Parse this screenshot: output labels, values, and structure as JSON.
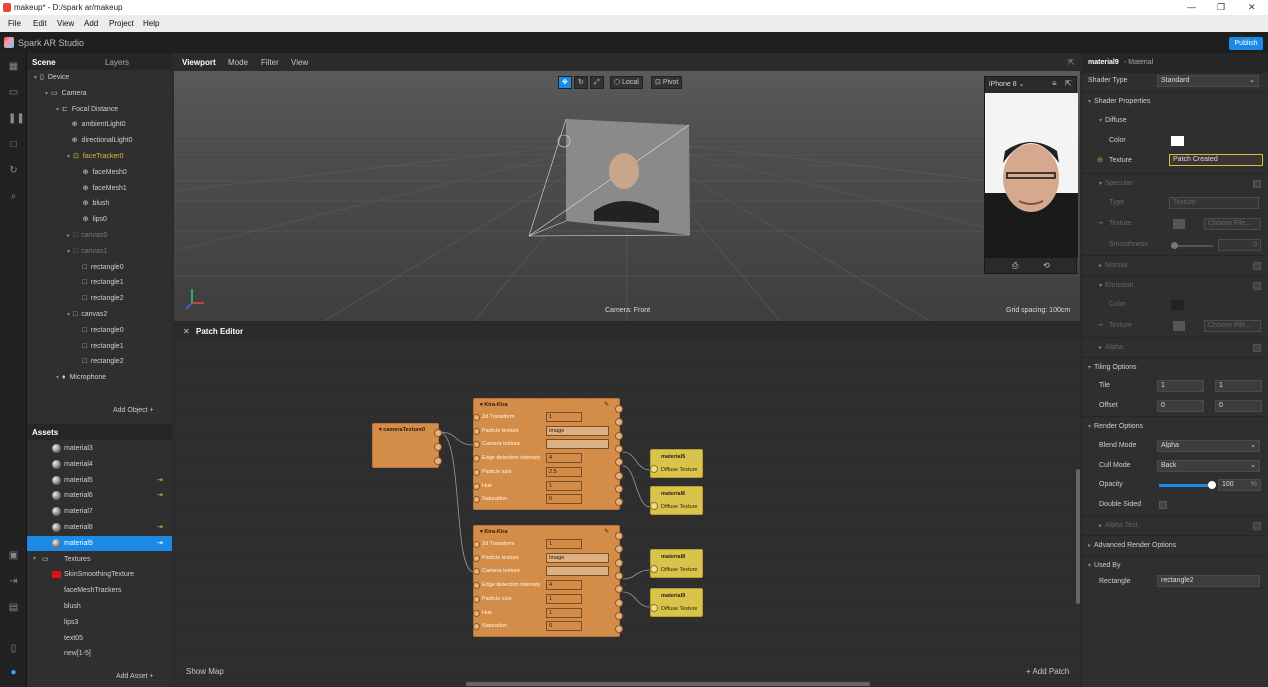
{
  "window": {
    "title": "makeup* - D:/spark ar/makeup"
  },
  "menu": [
    "File",
    "Edit",
    "View",
    "Add",
    "Project",
    "Help"
  ],
  "app": {
    "brand": "Spark AR Studio",
    "publish": "Publish"
  },
  "scene": {
    "tabs": [
      "Scene",
      "Layers"
    ],
    "tree": [
      {
        "label": "Device",
        "d": 0,
        "icon": "device"
      },
      {
        "label": "Camera",
        "d": 1,
        "icon": "camera"
      },
      {
        "label": "Focal Distance",
        "d": 2,
        "icon": "focal"
      },
      {
        "label": "ambientLight0",
        "d": 3,
        "icon": "globe"
      },
      {
        "label": "directionalLight0",
        "d": 3,
        "icon": "globe"
      },
      {
        "label": "faceTracker0",
        "d": 3,
        "icon": "face",
        "hl": true
      },
      {
        "label": "faceMesh0",
        "d": 4,
        "icon": "globe"
      },
      {
        "label": "faceMesh1",
        "d": 4,
        "icon": "globe"
      },
      {
        "label": "blush",
        "d": 4,
        "icon": "globe"
      },
      {
        "label": "lips0",
        "d": 4,
        "icon": "globe"
      },
      {
        "label": "canvas0",
        "d": 3,
        "icon": "box",
        "dim": true
      },
      {
        "label": "canvas1",
        "d": 3,
        "icon": "box",
        "dim": true
      },
      {
        "label": "rectangle0",
        "d": 4,
        "icon": "box"
      },
      {
        "label": "rectangle1",
        "d": 4,
        "icon": "box"
      },
      {
        "label": "rectangle2",
        "d": 4,
        "icon": "box"
      },
      {
        "label": "canvas2",
        "d": 3,
        "icon": "box"
      },
      {
        "label": "rectangle0",
        "d": 4,
        "icon": "box"
      },
      {
        "label": "rectangle1",
        "d": 4,
        "icon": "box"
      },
      {
        "label": "rectangle2",
        "d": 4,
        "icon": "box"
      },
      {
        "label": "Microphone",
        "d": 2,
        "icon": "mic"
      }
    ],
    "add_object": "Add Object"
  },
  "assets": {
    "title": "Assets",
    "items": [
      {
        "label": "material3"
      },
      {
        "label": "material4"
      },
      {
        "label": "material5",
        "pin": true
      },
      {
        "label": "material6",
        "pin": true
      },
      {
        "label": "material7"
      },
      {
        "label": "material8",
        "pin": true
      },
      {
        "label": "material9",
        "pin": true,
        "selected": true
      }
    ],
    "textures_folder": "Textures",
    "textures": [
      "SkinSmoothingTexture",
      "faceMeshTrackers",
      "blush",
      "lips3",
      "text05",
      "new[1-5]"
    ],
    "add_asset": "Add Asset"
  },
  "viewport": {
    "tabs": [
      "Viewport",
      "Mode",
      "Filter",
      "View"
    ],
    "local": "Local",
    "pivot": "Pivot",
    "camera_label": "Camera: Front",
    "grid": "Grid spacing: 100cm",
    "device": "iPhone 8"
  },
  "patch_editor": {
    "title": "Patch Editor",
    "show_map": "Show Map",
    "add_patch": "Add Patch",
    "camera_node": "cameraTexture0",
    "kira_nodes": [
      {
        "title": "Kira-Kira",
        "rows": [
          {
            "n": "2d Transform",
            "v": "1"
          },
          {
            "n": "Particle texture",
            "v": "Image",
            "w": true
          },
          {
            "n": "Camera texture",
            "v": "",
            "w": true
          },
          {
            "n": "Edge detection intensity",
            "v": "4"
          },
          {
            "n": "Particle size",
            "v": "2.5"
          },
          {
            "n": "Hue",
            "v": "1"
          },
          {
            "n": "Saturation",
            "v": "0"
          }
        ]
      },
      {
        "title": "Kira-Kira",
        "rows": [
          {
            "n": "2d Transform",
            "v": "1"
          },
          {
            "n": "Particle texture",
            "v": "Image",
            "w": true
          },
          {
            "n": "Camera texture",
            "v": "",
            "w": true
          },
          {
            "n": "Edge detection intensity",
            "v": "4"
          },
          {
            "n": "Particle size",
            "v": "1"
          },
          {
            "n": "Hue",
            "v": "1"
          },
          {
            "n": "Saturation",
            "v": "0"
          }
        ]
      }
    ],
    "materials": [
      {
        "name": "material5",
        "port": "Diffuse Texture"
      },
      {
        "name": "material6",
        "port": "Diffuse Texture"
      },
      {
        "name": "material8",
        "port": "Diffuse Texture"
      },
      {
        "name": "material9",
        "port": "Diffuse Texture"
      }
    ]
  },
  "properties": {
    "title": "material9",
    "subtitle": "- Material",
    "shader_type_label": "Shader Type",
    "shader_type": "Standard",
    "shader_props": "Shader Properties",
    "diffuse": "Diffuse",
    "color": "Color",
    "texture": "Texture",
    "texture_value": "Patch Created",
    "specular": "Specular",
    "type": "Type",
    "type_value": "Texture",
    "choose_file": "Choose File...",
    "smoothness": "Smoothness",
    "smoothness_value": "0",
    "normal": "Normal",
    "emission": "Emission",
    "alpha": "Alpha",
    "tiling": "Tiling Options",
    "tile": "Tile",
    "tile_x": "1",
    "tile_y": "1",
    "offset": "Offset",
    "offset_x": "0",
    "offset_y": "0",
    "render": "Render Options",
    "blend_mode": "Blend Mode",
    "blend_value": "Alpha",
    "cull_mode": "Cull Mode",
    "cull_value": "Back",
    "opacity": "Opacity",
    "opacity_value": "100",
    "opacity_unit": "%",
    "opacity_level": 1.0,
    "double_sided": "Double Sided",
    "alpha_test": "Alpha Test",
    "advanced": "Advanced Render Options",
    "used_by": "Used By",
    "rectangle_label": "Rectangle",
    "rectangle_value": "rectangle2"
  },
  "colors": {
    "accent": "#1a8ae6",
    "patch": "#d38d48",
    "material": "#d9c34a",
    "highlight": "#e5b542"
  }
}
